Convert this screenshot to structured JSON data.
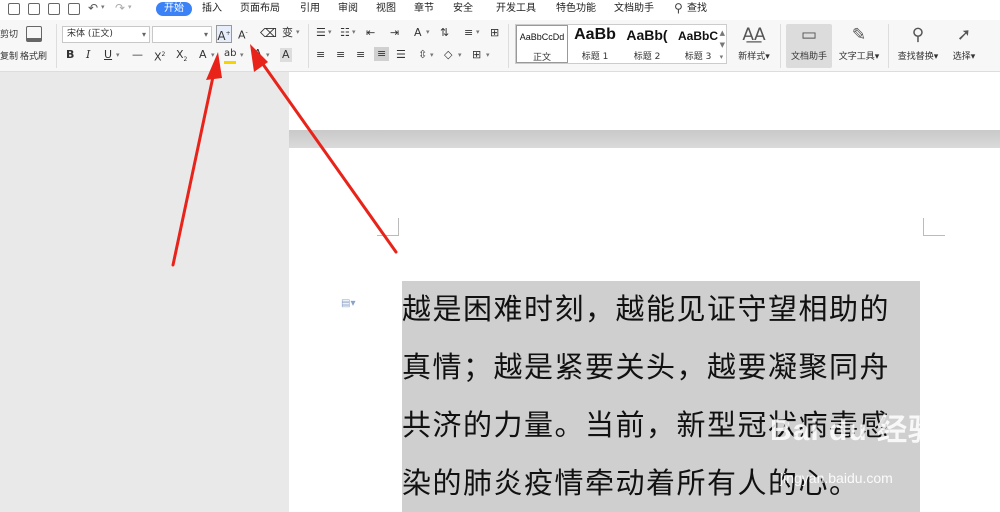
{
  "menubar": {
    "tabs": [
      "开始",
      "插入",
      "页面布局",
      "引用",
      "审阅",
      "视图",
      "章节",
      "安全",
      "开发工具",
      "特色功能",
      "文档助手"
    ],
    "active_tab": "开始",
    "search_label": "查找",
    "accent_color": "#3b82f6"
  },
  "ribbon": {
    "cut_label": "剪切",
    "copy_label": "复制",
    "format_painter_label": "格式刷",
    "font_name": "宋体 (正文)",
    "font_size": "",
    "styles": [
      {
        "sample": "AaBbCcDd",
        "name": "正文"
      },
      {
        "sample": "AaBb",
        "name": "标题 1"
      },
      {
        "sample": "AaBb(",
        "name": "标题 2"
      },
      {
        "sample": "AaBbC",
        "name": "标题 3"
      }
    ],
    "new_style_label": "新样式",
    "doc_assistant_label": "文档助手",
    "text_tools_label": "文字工具",
    "find_replace_label": "查找替换",
    "select_label": "选择"
  },
  "document": {
    "lines": [
      "越是困难时刻，越能见证守望相助的",
      "真情；越是紧要关头，越要凝聚同舟",
      "共济的力量。当前，新型冠状病毒感",
      "染的肺炎疫情牵动着所有人的心。"
    ],
    "selection_color": "#cfcfcf"
  },
  "watermark": {
    "logo": "Bai du 经验",
    "url": "jingyan.baidu.com"
  },
  "annotation": {
    "arrow_color": "#e8231a"
  }
}
